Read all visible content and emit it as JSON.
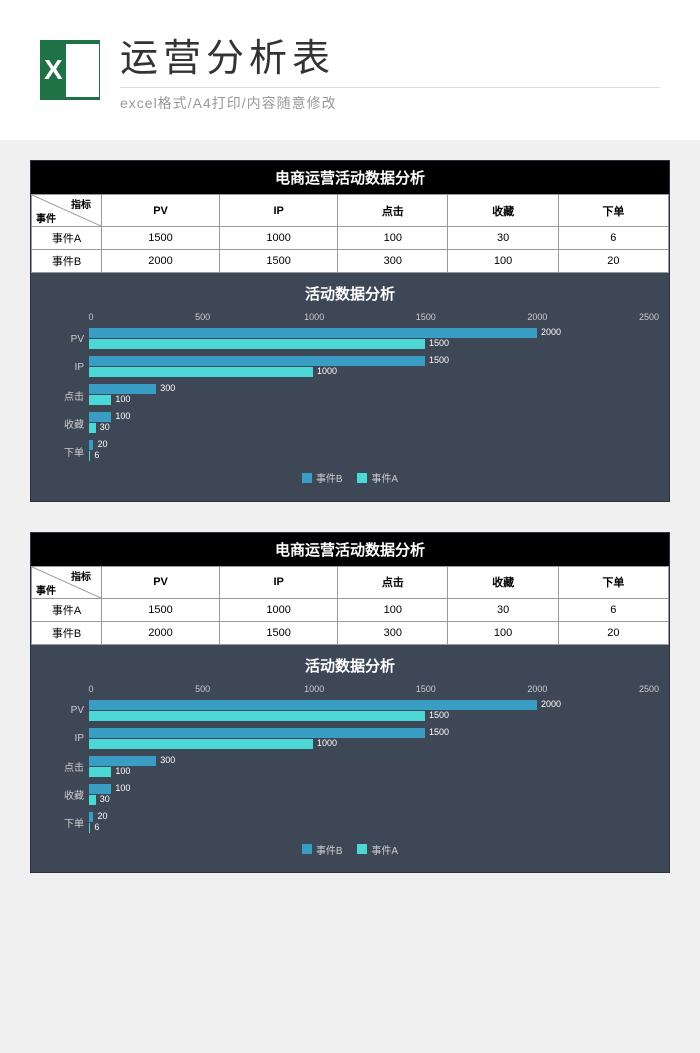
{
  "header": {
    "title": "运营分析表",
    "subtitle": "excel格式/A4打印/内容随意修改"
  },
  "panel": {
    "title": "电商运营活动数据分析",
    "corner_top": "指标",
    "corner_bottom": "事件",
    "columns": [
      "PV",
      "IP",
      "点击",
      "收藏",
      "下单"
    ],
    "rows": [
      {
        "label": "事件A",
        "values": [
          1500,
          1000,
          100,
          30,
          6
        ]
      },
      {
        "label": "事件B",
        "values": [
          2000,
          1500,
          300,
          100,
          20
        ]
      }
    ]
  },
  "chart_data": {
    "type": "bar",
    "title": "活动数据分析",
    "orientation": "horizontal",
    "categories": [
      "PV",
      "IP",
      "点击",
      "收藏",
      "下单"
    ],
    "series": [
      {
        "name": "事件B",
        "values": [
          2000,
          1500,
          300,
          100,
          20
        ],
        "color": "#3a9ec4"
      },
      {
        "name": "事件A",
        "values": [
          1500,
          1000,
          100,
          30,
          6
        ],
        "color": "#4dd8d8"
      }
    ],
    "xlim": [
      0,
      2500
    ],
    "xticks": [
      0,
      500,
      1000,
      1500,
      2000,
      2500
    ],
    "xlabel": "",
    "ylabel": "",
    "legend_position": "bottom"
  },
  "legend": {
    "b": "事件B",
    "a": "事件A"
  }
}
